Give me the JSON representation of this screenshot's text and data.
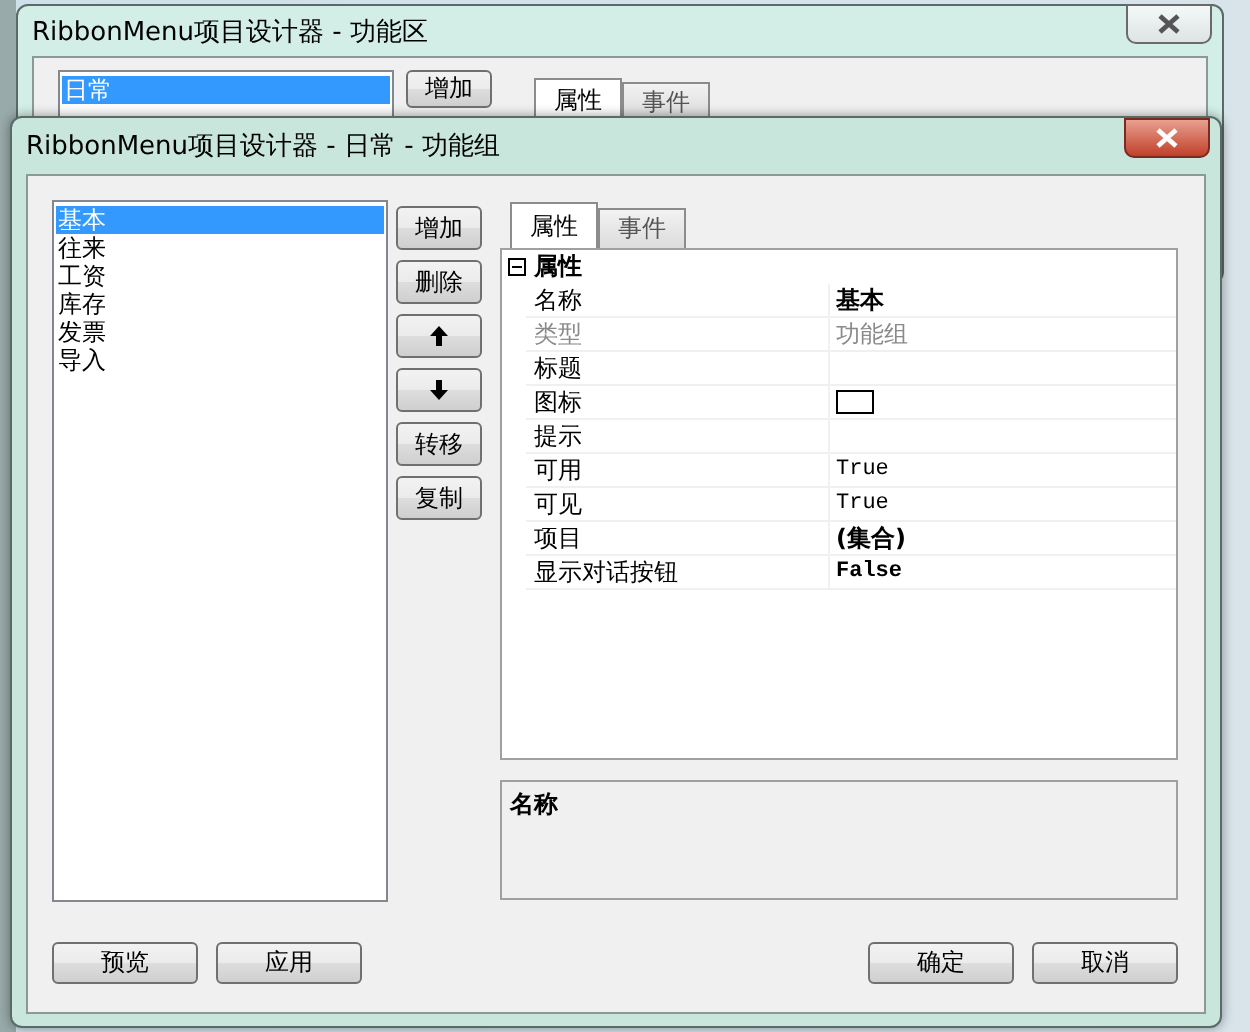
{
  "back_window": {
    "title": "RibbonMenu项目设计器 - 功能区",
    "list_items": [
      {
        "label": "日常",
        "selected": true
      }
    ],
    "buttons": [
      "增加"
    ],
    "tabs": [
      {
        "label": "属性",
        "selected": true
      },
      {
        "label": "事件",
        "selected": false
      }
    ]
  },
  "window": {
    "title": "RibbonMenu项目设计器 - 日常 - 功能组",
    "list_items": [
      {
        "label": "基本",
        "selected": true
      },
      {
        "label": "往来",
        "selected": false
      },
      {
        "label": "工资",
        "selected": false
      },
      {
        "label": "库存",
        "selected": false
      },
      {
        "label": "发票",
        "selected": false
      },
      {
        "label": "导入",
        "selected": false
      }
    ],
    "side_buttons": [
      {
        "kind": "text",
        "label": "增加"
      },
      {
        "kind": "text",
        "label": "删除"
      },
      {
        "kind": "up"
      },
      {
        "kind": "down"
      },
      {
        "kind": "text",
        "label": "转移"
      },
      {
        "kind": "text",
        "label": "复制"
      }
    ],
    "tabs": [
      {
        "label": "属性",
        "selected": true
      },
      {
        "label": "事件",
        "selected": false
      }
    ],
    "property_grid": {
      "category": "属性",
      "expanded": true,
      "rows": [
        {
          "name": "名称",
          "kind": "bold",
          "value": "基本",
          "disabled": false
        },
        {
          "name": "类型",
          "kind": "text",
          "value": "功能组",
          "disabled": true
        },
        {
          "name": "标题",
          "kind": "empty",
          "disabled": false
        },
        {
          "name": "图标",
          "kind": "swatch",
          "disabled": false
        },
        {
          "name": "提示",
          "kind": "empty",
          "disabled": false
        },
        {
          "name": "可用",
          "kind": "mono",
          "value": "True",
          "disabled": false
        },
        {
          "name": "可见",
          "kind": "mono",
          "value": "True",
          "disabled": false
        },
        {
          "name": "项目",
          "kind": "bold",
          "value": "(集合)",
          "disabled": false
        },
        {
          "name": "显示对话按钮",
          "kind": "mono-bold",
          "value": "False",
          "disabled": false
        }
      ]
    },
    "description": {
      "title": "名称"
    },
    "footer_left": [
      "预览",
      "应用"
    ],
    "footer_right": [
      "确定",
      "取消"
    ]
  }
}
